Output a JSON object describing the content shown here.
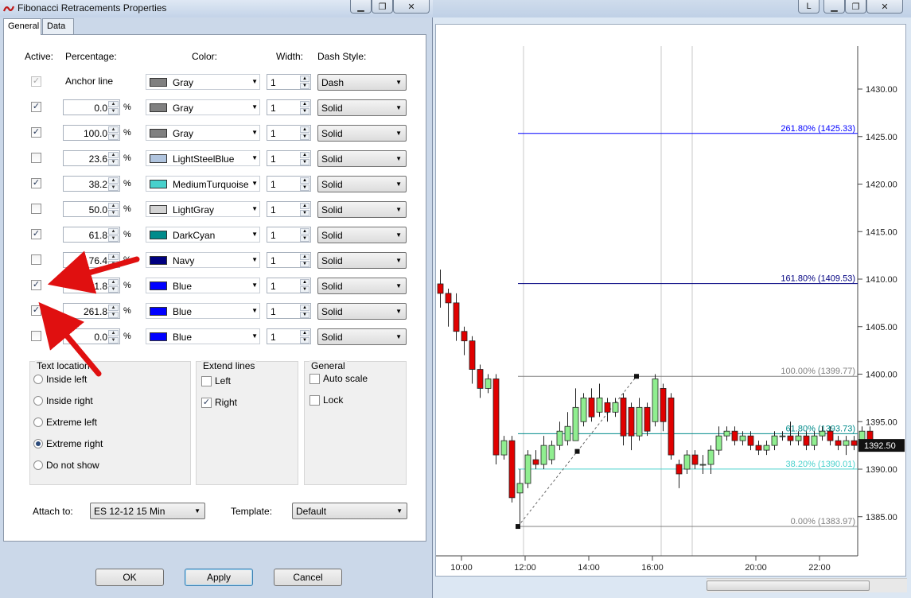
{
  "dialog": {
    "title": "Fibonacci Retracements Properties",
    "tabs": [
      "General",
      "Data"
    ],
    "headers": {
      "active": "Active:",
      "percentage": "Percentage:",
      "color": "Color:",
      "width": "Width:",
      "dash": "Dash Style:"
    },
    "anchor": {
      "label": "Anchor line",
      "checked": true,
      "color": "Gray",
      "swatch": "#808080",
      "width": "1",
      "dash": "Dash"
    },
    "pct_suffix": "%",
    "levels": [
      {
        "checked": true,
        "pct": "0.0",
        "color": "Gray",
        "swatch": "#808080",
        "width": "1",
        "dash": "Solid"
      },
      {
        "checked": true,
        "pct": "100.0",
        "color": "Gray",
        "swatch": "#808080",
        "width": "1",
        "dash": "Solid"
      },
      {
        "checked": false,
        "pct": "23.6",
        "color": "LightSteelBlue",
        "swatch": "#b0c4de",
        "width": "1",
        "dash": "Solid"
      },
      {
        "checked": true,
        "pct": "38.2",
        "color": "MediumTurquoise",
        "swatch": "#48d1cc",
        "width": "1",
        "dash": "Solid"
      },
      {
        "checked": false,
        "pct": "50.0",
        "color": "LightGray",
        "swatch": "#d3d3d3",
        "width": "1",
        "dash": "Solid"
      },
      {
        "checked": true,
        "pct": "61.8",
        "color": "DarkCyan",
        "swatch": "#008b8b",
        "width": "1",
        "dash": "Solid"
      },
      {
        "checked": false,
        "pct": "76.4",
        "color": "Navy",
        "swatch": "#000080",
        "width": "1",
        "dash": "Solid"
      },
      {
        "checked": true,
        "pct": "161.8",
        "color": "Blue",
        "swatch": "#0000ff",
        "width": "1",
        "dash": "Solid"
      },
      {
        "checked": true,
        "pct": "261.8",
        "color": "Blue",
        "swatch": "#0000ff",
        "width": "1",
        "dash": "Solid"
      },
      {
        "checked": false,
        "pct": "0.0",
        "color": "Blue",
        "swatch": "#0000ff",
        "width": "1",
        "dash": "Solid"
      }
    ],
    "text_location": {
      "title": "Text location",
      "options": [
        "Inside left",
        "Inside right",
        "Extreme left",
        "Extreme right",
        "Do not show"
      ],
      "selected": "Extreme right"
    },
    "extend_lines": {
      "title": "Extend lines",
      "left_label": "Left",
      "left_checked": false,
      "right_label": "Right",
      "right_checked": true
    },
    "general": {
      "title": "General",
      "autoscale_label": "Auto scale",
      "autoscale_checked": false,
      "lock_label": "Lock",
      "lock_checked": false
    },
    "attach_label": "Attach to:",
    "attach_value": "ES 12-12 15 Min",
    "template_label": "Template:",
    "template_value": "Default",
    "ok_label": "OK",
    "apply_label": "Apply",
    "cancel_label": "Cancel"
  },
  "chart_window": {
    "btn_l": "L",
    "price_axis": [
      "1430.00",
      "1425.00",
      "1420.00",
      "1415.00",
      "1410.00",
      "1405.00",
      "1400.00",
      "1395.00",
      "1390.00",
      "1385.00"
    ],
    "time_axis": [
      "10:00",
      "12:00",
      "14:00",
      "16:00",
      "20:00",
      "22:00"
    ],
    "current_price": "1392.50",
    "fib_labels": [
      {
        "text": "261.80% (1425.33)",
        "price": 1425.33,
        "color": "#0000ff"
      },
      {
        "text": "161.80% (1409.53)",
        "price": 1409.53,
        "color": "#000080"
      },
      {
        "text": "100.00% (1399.77)",
        "price": 1399.77,
        "color": "#808080"
      },
      {
        "text": "61.80% (1393.73)",
        "price": 1393.73,
        "color": "#008b8b"
      },
      {
        "text": "38.20% (1390.01)",
        "price": 1390.01,
        "color": "#48d1cc"
      },
      {
        "text": "0.00% (1383.97)",
        "price": 1383.97,
        "color": "#808080"
      }
    ],
    "up_color": "#90ee90",
    "down_color": "#e00000",
    "arrow_color": "#e01010"
  }
}
